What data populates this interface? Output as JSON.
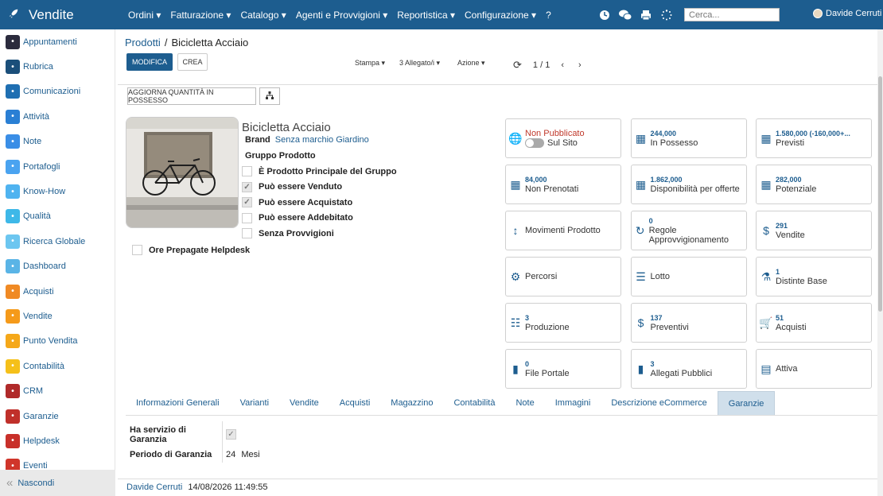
{
  "topbar": {
    "app_title": "Vendite",
    "menus": [
      "Ordini ▾",
      "Fatturazione ▾",
      "Catalogo ▾",
      "Agenti e Provvigioni ▾",
      "Reportistica ▾",
      "Configurazione ▾",
      "?"
    ],
    "search_placeholder": "Cerca...",
    "user_name": "Davide Cerruti",
    "bg_color": "#1d5d8f"
  },
  "sidebar": {
    "items": [
      {
        "label": "Appuntamenti",
        "icon": "calendar-icon",
        "color": "#2b2b3d"
      },
      {
        "label": "Rubrica",
        "icon": "contacts-icon",
        "color": "#1b4f7a"
      },
      {
        "label": "Comunicazioni",
        "icon": "chat-icon",
        "color": "#1f6fb2"
      },
      {
        "label": "Attività",
        "icon": "check-icon",
        "color": "#2a7fd4"
      },
      {
        "label": "Note",
        "icon": "note-icon",
        "color": "#3a8ee6"
      },
      {
        "label": "Portafogli",
        "icon": "lock-icon",
        "color": "#4aa3f0"
      },
      {
        "label": "Know-How",
        "icon": "brain-icon",
        "color": "#4fb3f0"
      },
      {
        "label": "Qualità",
        "icon": "quality-icon",
        "color": "#3eb8e8"
      },
      {
        "label": "Ricerca Globale",
        "icon": "search-icon",
        "color": "#6cc6f0"
      },
      {
        "label": "Dashboard",
        "icon": "dashboard-icon",
        "color": "#5ab4e6"
      },
      {
        "label": "Acquisti",
        "icon": "purchase-icon",
        "color": "#f08a24"
      },
      {
        "label": "Vendite",
        "icon": "chart-icon",
        "color": "#f59a1a"
      },
      {
        "label": "Punto Vendita",
        "icon": "pos-icon",
        "color": "#f5a81a"
      },
      {
        "label": "Contabilità",
        "icon": "accounting-icon",
        "color": "#f5c01a"
      },
      {
        "label": "CRM",
        "icon": "handshake-icon",
        "color": "#b02a2a"
      },
      {
        "label": "Garanzie",
        "icon": "shield-icon",
        "color": "#c0302a"
      },
      {
        "label": "Helpdesk",
        "icon": "headset-icon",
        "color": "#c8302a"
      },
      {
        "label": "Eventi",
        "icon": "ticket-icon",
        "color": "#d0352a"
      }
    ],
    "hide_label": "Nascondi"
  },
  "breadcrumb": {
    "parent": "Prodotti",
    "separator": "/",
    "current": "Bicicletta Acciaio"
  },
  "toolbar": {
    "edit_label": "MODIFICA",
    "create_label": "CREA",
    "print_label": "Stampa ▾",
    "attachments_label": "3 Allegato/i ▾",
    "action_label": "Azione ▾",
    "pager": "1 / 1"
  },
  "form_toolbar": {
    "update_qty_label": "AGGIORNA QUANTITÀ IN POSSESSO"
  },
  "product": {
    "name": "Bicicletta Acciaio",
    "brand_label": "Brand",
    "brand_value": "Senza marchio Giardino",
    "group_label": "Gruppo Prodotto",
    "checks": [
      {
        "label": "È Prodotto Principale del Gruppo",
        "checked": false
      },
      {
        "label": "Può essere Venduto",
        "checked": true
      },
      {
        "label": "Può essere Acquistato",
        "checked": true
      },
      {
        "label": "Può essere Addebitato",
        "checked": false
      },
      {
        "label": "Senza Provvigioni",
        "checked": false
      }
    ],
    "helpdesk_label": "Ore Prepagate Helpdesk"
  },
  "smart_buttons": [
    {
      "num": "",
      "label": "Non Pubblicato",
      "sub": "Sul Sito",
      "icon": "globe-icon"
    },
    {
      "num": "244,000",
      "label": "In Possesso",
      "icon": "building-icon"
    },
    {
      "num": "1.580,000 (-160,000+...",
      "label": "Previsti",
      "icon": "building-icon"
    },
    {
      "num": "84,000",
      "label": "Non Prenotati",
      "icon": "building-icon"
    },
    {
      "num": "1.862,000",
      "label": "Disponibilità per offerte",
      "icon": "building-icon"
    },
    {
      "num": "282,000",
      "label": "Potenziale",
      "icon": "building-icon"
    },
    {
      "num": "",
      "label": "Movimenti Prodotto",
      "icon": "arrows-vertical-icon"
    },
    {
      "num": "0",
      "label": "Regole Approvvigionamento",
      "icon": "refresh-icon"
    },
    {
      "num": "291",
      "label": "Vendite",
      "icon": "dollar-icon"
    },
    {
      "num": "",
      "label": "Percorsi",
      "icon": "gears-icon"
    },
    {
      "num": "",
      "label": "Lotto",
      "icon": "bars-icon"
    },
    {
      "num": "1",
      "label": "Distinte Base",
      "icon": "flask-icon"
    },
    {
      "num": "3",
      "label": "Produzione",
      "icon": "list-icon"
    },
    {
      "num": "137",
      "label": "Preventivi",
      "icon": "dollar-icon"
    },
    {
      "num": "51",
      "label": "Acquisti",
      "icon": "cart-icon"
    },
    {
      "num": "0",
      "label": "File Portale",
      "icon": "file-icon"
    },
    {
      "num": "3",
      "label": "Allegati Pubblici",
      "icon": "file-icon"
    },
    {
      "num": "",
      "label": "Attiva",
      "icon": "archive-icon"
    }
  ],
  "tabs": [
    "Informazioni Generali",
    "Varianti",
    "Vendite",
    "Acquisti",
    "Magazzino",
    "Contabilità",
    "Note",
    "Immagini",
    "Descrizione eCommerce",
    "Garanzie"
  ],
  "active_tab": "Garanzie",
  "warranty": {
    "service_label": "Ha servizio di Garanzia",
    "period_label": "Periodo di Garanzia",
    "period_value": "24",
    "period_unit": "Mesi"
  },
  "footer": {
    "user": "Davide Cerruti",
    "timestamp": "14/08/2026 11:49:55"
  }
}
